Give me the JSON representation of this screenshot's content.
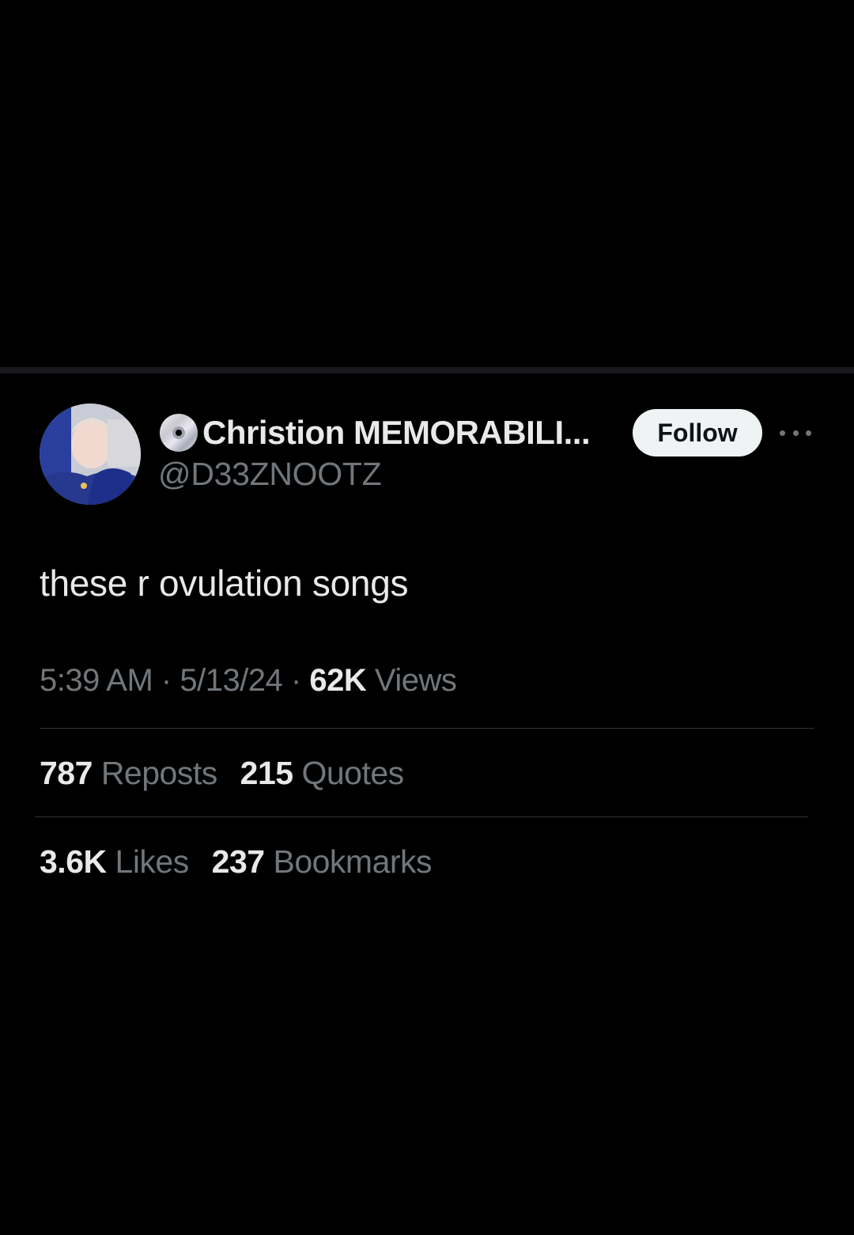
{
  "author": {
    "display_name": "Christion MEMORABILI...",
    "handle": "@D33ZNOOTZ",
    "avatar_icon": "profile-photo",
    "name_emoji_icon": "cd-disc-icon"
  },
  "follow_button_label": "Follow",
  "more_icon": "more-options-icon",
  "tweet": {
    "text": "these r ovulation songs",
    "time": "5:39 AM",
    "date": "5/13/24",
    "separator": "·",
    "views_count": "62K",
    "views_label": "Views"
  },
  "stats": {
    "reposts_count": "787",
    "reposts_label": "Reposts",
    "quotes_count": "215",
    "quotes_label": "Quotes",
    "likes_count": "3.6K",
    "likes_label": "Likes",
    "bookmarks_count": "237",
    "bookmarks_label": "Bookmarks"
  },
  "colors": {
    "background": "#000000",
    "primary_text": "#e7e9ea",
    "secondary_text": "#71767b",
    "divider": "#2f3336",
    "follow_button_bg": "#eff3f4"
  }
}
